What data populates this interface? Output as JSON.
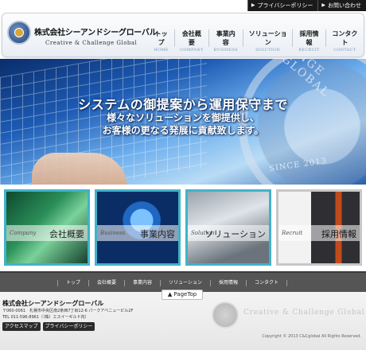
{
  "top_links": [
    {
      "label": "プライバシーポリシー"
    },
    {
      "label": "お問い合わせ"
    }
  ],
  "logo": {
    "name": "株式会社シーアンドシーグローバル",
    "tagline": "Creative & Challenge Global"
  },
  "global_nav": [
    {
      "jp": "トップ",
      "en": "HOME"
    },
    {
      "jp": "会社概要",
      "en": "COMPANY"
    },
    {
      "jp": "事業内容",
      "en": "BUSINESS"
    },
    {
      "jp": "ソリューション",
      "en": "SOLUTION"
    },
    {
      "jp": "採用情報",
      "en": "RECRUIT"
    },
    {
      "jp": "コンタクト",
      "en": "CONTACT"
    }
  ],
  "hero": {
    "headline": "システムの御提案から運用保守まで",
    "sub_line1": "様々なソリューションを御提供し、",
    "sub_line2": "お客様の更なる発展に貢献致します。",
    "seal_text": "ENGE GLOBAL",
    "since": "SINCE 2013"
  },
  "tiles": [
    {
      "en": "Company",
      "jp": "会社概要"
    },
    {
      "en": "Business",
      "jp": "事業内容"
    },
    {
      "en": "Solution",
      "jp": "ソリューション"
    },
    {
      "en": "Recruit",
      "jp": "採用情報"
    }
  ],
  "footer_nav": [
    "トップ",
    "会社概要",
    "事業内容",
    "ソリューション",
    "採用情報",
    "コンタクト"
  ],
  "pagetop": "▲ PageTop",
  "footer": {
    "company": "株式会社シーアンドシーグローバル",
    "address": "〒060-0061　札幌市中央区南2条西7丁目12-6 パークアベニュービル2F",
    "tel": "TEL 011-596-8961（（株）エスイーギルド内）",
    "buttons": [
      "アクセスマップ",
      "プライバシーポリシー"
    ],
    "slogan": "Creative & Challenge Global",
    "copyright": "Copyright © 2013 C&Cglobal All Rights Reserved."
  }
}
